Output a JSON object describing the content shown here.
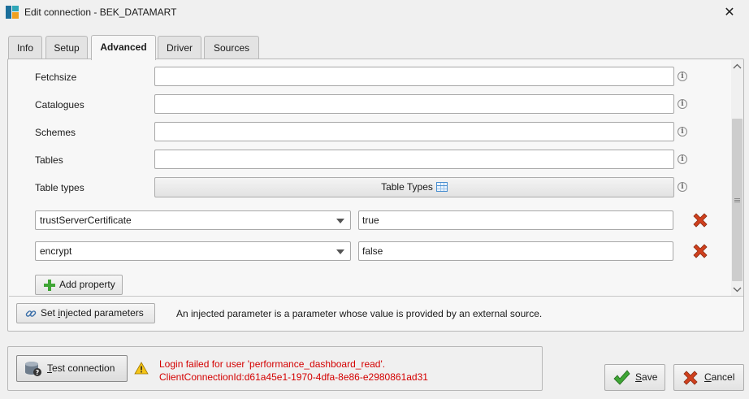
{
  "window": {
    "title": "Edit connection - BEK_DATAMART",
    "close_glyph": "✕"
  },
  "tabs": [
    {
      "label": "Info"
    },
    {
      "label": "Setup"
    },
    {
      "label": "Advanced",
      "active": true
    },
    {
      "label": "Driver"
    },
    {
      "label": "Sources"
    }
  ],
  "advanced": {
    "fields": [
      {
        "label": "Fetchsize",
        "value": ""
      },
      {
        "label": "Catalogues",
        "value": ""
      },
      {
        "label": "Schemes",
        "value": ""
      },
      {
        "label": "Tables",
        "value": ""
      }
    ],
    "table_types": {
      "label": "Table types",
      "button_label": "Table Types"
    },
    "properties": [
      {
        "key": "trustServerCertificate",
        "value": "true"
      },
      {
        "key": "encrypt",
        "value": "false"
      }
    ],
    "add_property_label": "Add property",
    "info_glyph": "i"
  },
  "injected": {
    "button_prefix": "Set ",
    "button_underline": "i",
    "button_suffix": "njected parameters",
    "description": "An injected parameter is a parameter whose value is provided by an external source."
  },
  "test": {
    "button_underline": "T",
    "button_suffix": "est connection",
    "error_line1": "Login failed for user 'performance_dashboard_read'.",
    "error_line2": "ClientConnectionId:d61a45e1-1970-4dfa-8e86-e2980861ad31"
  },
  "actions": {
    "save_underline": "S",
    "save_suffix": "ave",
    "cancel_underline": "C",
    "cancel_suffix": "ancel"
  },
  "colors": {
    "error_text": "#d40000",
    "delete_icon": "#d0401e",
    "add_icon": "#3fa535",
    "save_check": "#3fa535"
  }
}
